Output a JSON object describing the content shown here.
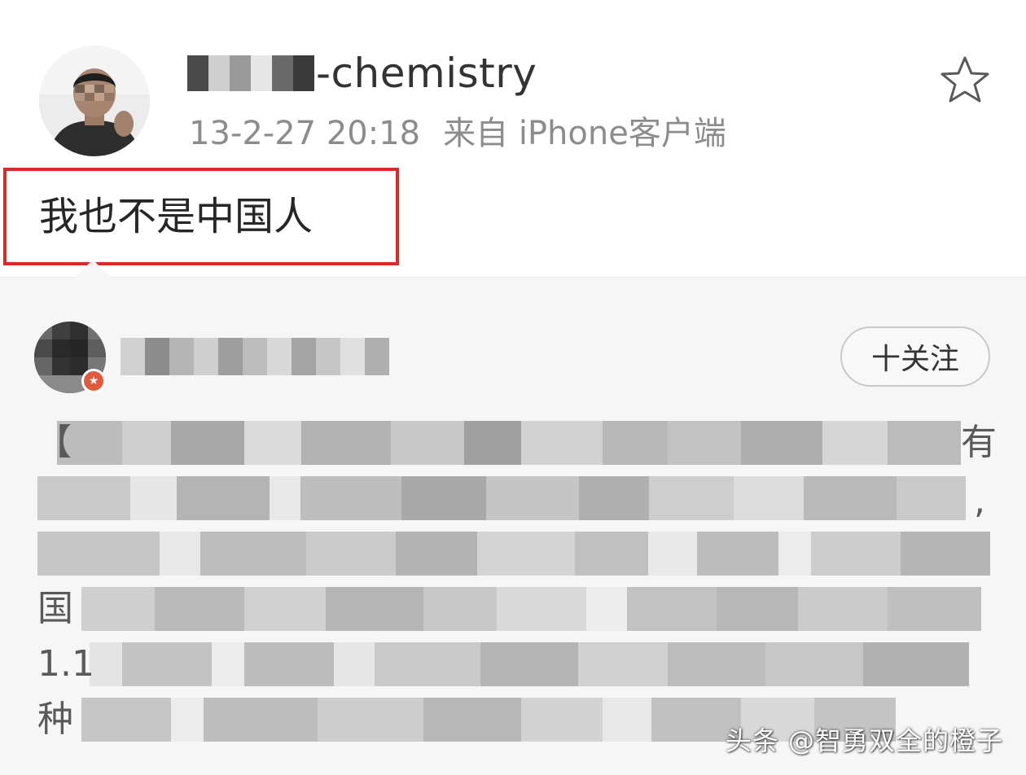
{
  "post": {
    "username": "-chemistry",
    "timestamp": "13-2-27 20:18",
    "source": "来自 iPhone客户端",
    "content": "我也不是中国人",
    "favorite_icon": "star-outline-icon",
    "highlight_color": "#d62b2b"
  },
  "repost": {
    "follow_label": "十关注",
    "badge_icon": "verified-star-icon",
    "visible_fragments": {
      "line1_start": "【",
      "line1_end": "有",
      "line2_end": ",",
      "line4_start": "国",
      "line5_start": "1.1",
      "line6_start": "种"
    }
  },
  "watermark": "头条 @智勇双全的橙子"
}
